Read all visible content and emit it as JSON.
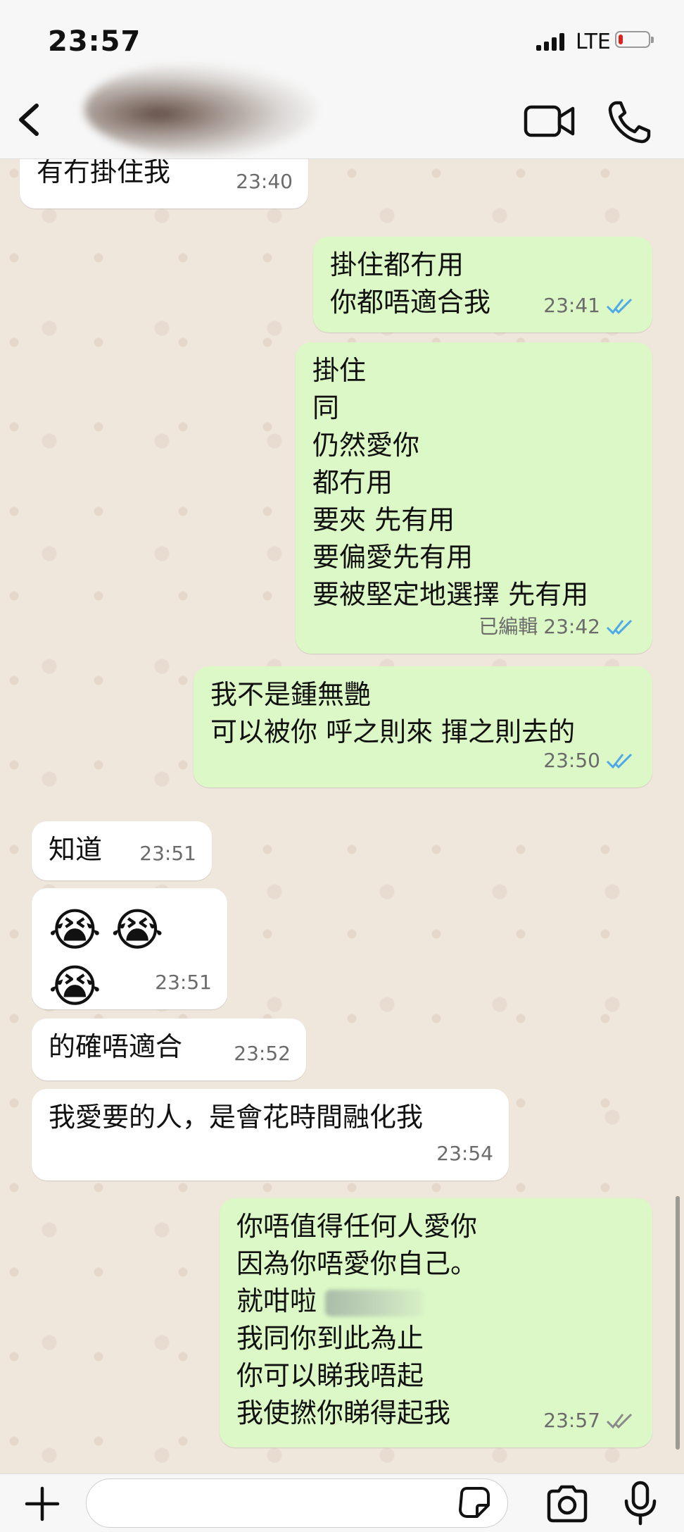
{
  "status_bar": {
    "time": "23:57",
    "network": "LTE",
    "battery_level": 0.15,
    "battery_color": "#e0211b"
  },
  "header": {
    "back_icon": "chevron-left-icon",
    "video_icon": "video-camera-icon",
    "call_icon": "phone-icon"
  },
  "colors": {
    "incoming_bubble": "#ffffff",
    "outgoing_bubble": "#dcf8c6",
    "read_tick": "#4fa8e8",
    "delivered_tick": "#8a8a8a"
  },
  "messages": [
    {
      "direction": "in",
      "text": "有冇掛住我",
      "time": "23:40"
    },
    {
      "direction": "out",
      "text": "掛住都冇用\n你都唔適合我",
      "time": "23:41",
      "status": "read"
    },
    {
      "direction": "out",
      "text": "掛住\n同\n仍然愛你\n都冇用\n要夾 先有用\n要偏愛先有用\n要被堅定地選擇 先有用",
      "time": "23:42",
      "edited_label": "已編輯",
      "status": "read"
    },
    {
      "direction": "out",
      "text": "我不是鍾無艷\n可以被你 呼之則來 揮之則去的",
      "time": "23:50",
      "status": "read"
    },
    {
      "direction": "in",
      "text": "知道",
      "time": "23:51"
    },
    {
      "direction": "in",
      "text": "😭😭😭",
      "time": "23:51"
    },
    {
      "direction": "in",
      "text": "的確唔適合",
      "time": "23:52"
    },
    {
      "direction": "in",
      "text": "我愛要的人，是會花時間融化我",
      "time": "23:54"
    },
    {
      "direction": "out",
      "lines": [
        "你唔值得任何人愛你",
        "因為你唔愛你自己。",
        "就咁啦",
        "我同你到此為止",
        "你可以睇我唔起",
        "我使撚你睇得起我"
      ],
      "time": "23:57",
      "status": "delivered"
    }
  ],
  "composer": {
    "plus_icon": "plus-icon",
    "input_value": "",
    "sticker_icon": "sticker-icon",
    "camera_icon": "camera-icon",
    "mic_icon": "microphone-icon"
  }
}
